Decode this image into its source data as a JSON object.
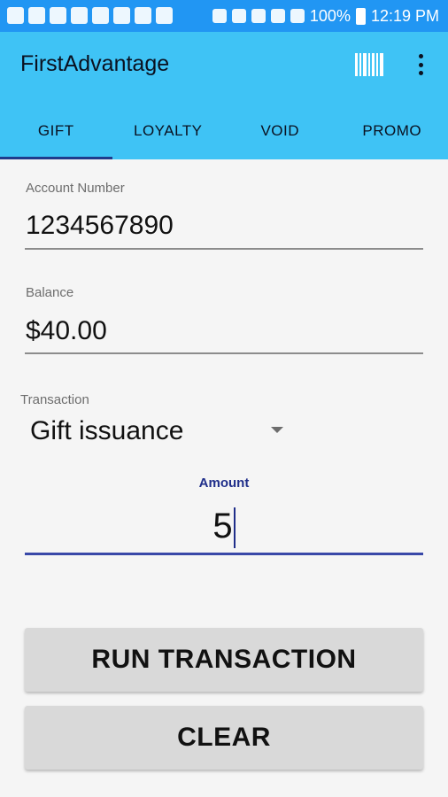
{
  "status_bar": {
    "left_icons": [
      "chat-icon",
      "facebook-icon",
      "wifi-shield-icon",
      "outlook-icon",
      "outlook-icon",
      "usb-icon",
      "image-icon",
      "outlook-icon"
    ],
    "battery_percent": "100%",
    "time": "12:19 PM"
  },
  "app_bar": {
    "title": "FirstAdvantage",
    "background": "#3fc3f5",
    "icons": [
      "barcode-icon",
      "overflow-menu-icon"
    ]
  },
  "tabs": [
    {
      "label": "GIFT",
      "active": true
    },
    {
      "label": "LOYALTY",
      "active": false
    },
    {
      "label": "VOID",
      "active": false
    },
    {
      "label": "PROMO",
      "active": false
    }
  ],
  "account": {
    "label": "Account Number",
    "value": "1234567890"
  },
  "balance": {
    "label": "Balance",
    "value": "$40.00"
  },
  "transaction": {
    "label": "Transaction",
    "selected": "Gift issuance"
  },
  "amount": {
    "label": "Amount",
    "value": "5",
    "accent": "#1f2e8a"
  },
  "buttons": {
    "run_label": "RUN TRANSACTION",
    "clear_label": "CLEAR"
  }
}
